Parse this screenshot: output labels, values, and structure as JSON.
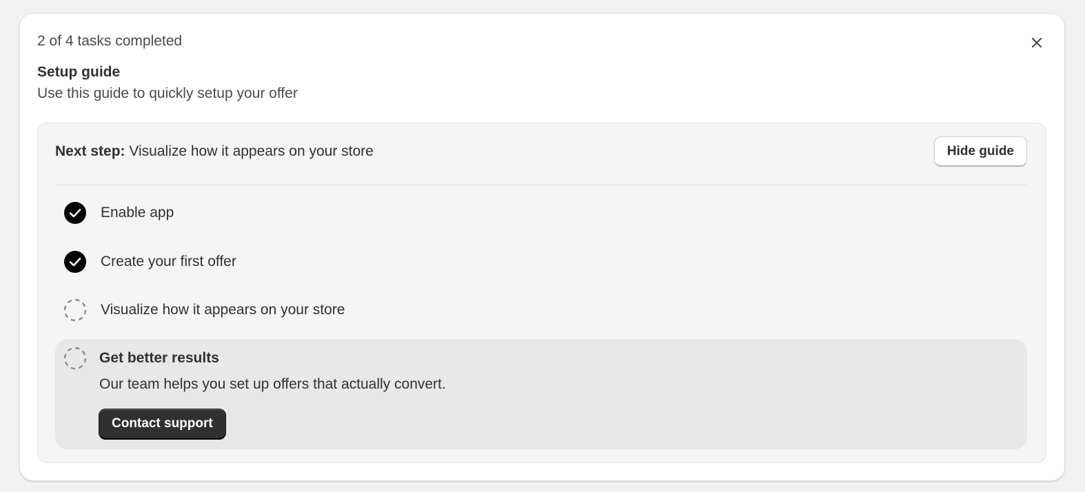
{
  "header": {
    "progress_text": "2 of 4 tasks completed",
    "close_icon": "close-icon",
    "title": "Setup guide",
    "subtitle": "Use this guide to quickly setup your offer"
  },
  "next_step": {
    "label": "Next step:",
    "value": "Visualize how it appears on your store",
    "hide_button": "Hide guide"
  },
  "tasks": [
    {
      "label": "Enable app",
      "status": "completed",
      "icon": "checkmark-circle-icon"
    },
    {
      "label": "Create your first offer",
      "status": "completed",
      "icon": "checkmark-circle-icon"
    },
    {
      "label": "Visualize how it appears on your store",
      "status": "incomplete",
      "icon": "dashed-circle-icon"
    },
    {
      "label": "Get better results",
      "status": "incomplete",
      "icon": "dashed-circle-icon",
      "description": "Our team helps you set up offers that actually convert.",
      "button": "Contact support"
    }
  ],
  "colors": {
    "background": "#f1f1f1",
    "card": "#ffffff",
    "panel": "#f5f5f5",
    "active_task": "#e8e8e8",
    "primary_button": "#303030",
    "check": "#000000"
  }
}
